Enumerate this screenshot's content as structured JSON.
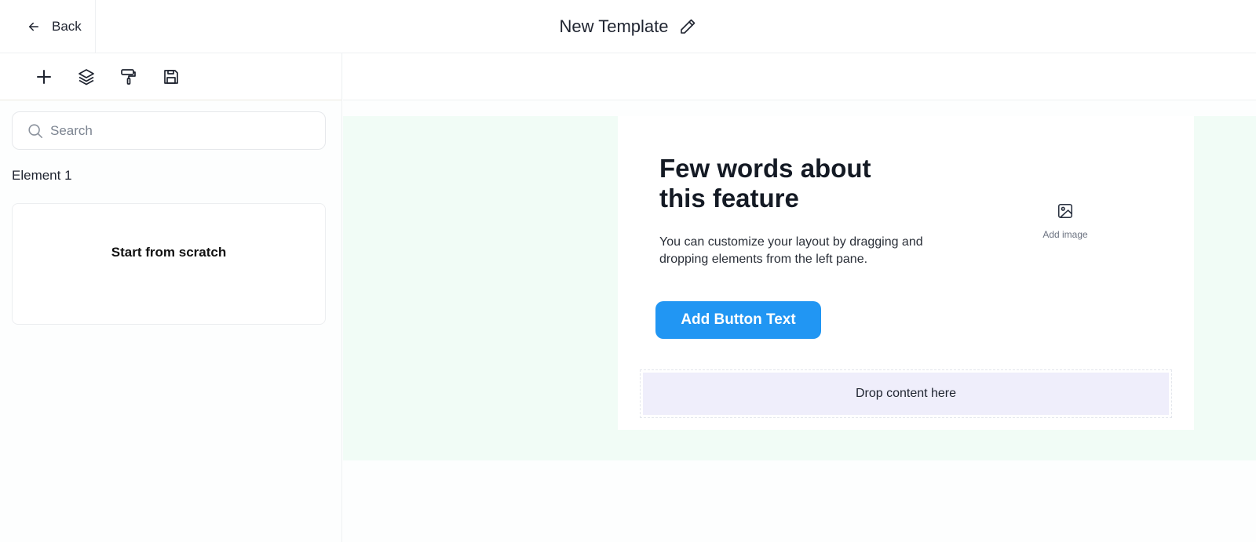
{
  "topbar": {
    "back_label": "Back",
    "template_title": "New Template"
  },
  "toolbar": {
    "tools": [
      "plus-icon",
      "layers-icon",
      "paint-roller-icon",
      "save-icon"
    ]
  },
  "search": {
    "placeholder": "Search",
    "value": ""
  },
  "elements": {
    "section_label": "Element 1",
    "card_label": "Start from scratch"
  },
  "canvas": {
    "headline": "Few words about this feature",
    "body": "You can customize your layout by dragging and dropping elements from the left pane.",
    "image_placeholder": "Add image",
    "button_text": "Add Button Text",
    "dropzone_text": "Drop content here"
  },
  "colors": {
    "accent_button": "#2196f3",
    "canvas_background": "#f1fcf6",
    "dropzone_background": "#efeefb"
  }
}
